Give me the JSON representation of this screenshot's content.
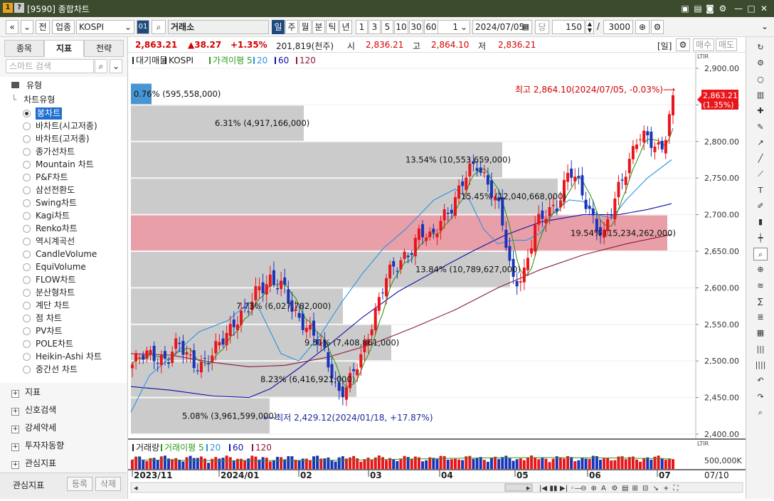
{
  "window": {
    "icon1": "1",
    "icon2": "?",
    "title": "[9590] 종합차트"
  },
  "toolbar": {
    "nav_prev": "«",
    "nav_more": "»",
    "whole": "전",
    "sector": "업종",
    "symbol": "KOSPI",
    "symbol_code": "01",
    "exchange": "거래소",
    "periods": [
      "일",
      "주",
      "월",
      "분",
      "틱",
      "년"
    ],
    "selected_period": "일",
    "intervals": [
      "1",
      "3",
      "5",
      "10",
      "30",
      "60"
    ],
    "spin_value": "1",
    "date": "2024/07/05",
    "dang": "당",
    "count": "150",
    "slash": "/",
    "max_count": "3000"
  },
  "quote": {
    "last": "2,863.21",
    "change": "▲38.27",
    "change_pct": "+1.35%",
    "volume": "201,819(천주)",
    "open_label": "시",
    "open": "2,836.21",
    "high_label": "고",
    "high": "2,864.10",
    "low_label": "저",
    "low": "2,836.21",
    "period_tag": "[일]",
    "buy": "매수",
    "sell": "매도"
  },
  "left_panel": {
    "tabs": [
      "종목",
      "지표",
      "전략"
    ],
    "selected_tab": "지표",
    "search_placeholder": "스마트 검색",
    "section_type": "유형",
    "section_chart_type": "차트유형",
    "chart_types": [
      "봉차트",
      "바차트(시고저종)",
      "바차트(고저종)",
      "종가선차트",
      "Mountain 차트",
      "P&F차트",
      "삼선전환도",
      "Swing차트",
      "Kagi차트",
      "Renko차트",
      "역시계곡선",
      "CandleVolume",
      "EquiVolume",
      "FLOW차트",
      "분산형차트",
      "계단 차트",
      "점 차트",
      "PV차트",
      "POLE차트",
      "Heikin-Ashi 차트",
      "중간선 차트"
    ],
    "selected_chart_type": "봉차트",
    "groups": [
      "지표",
      "신호검색",
      "강세약세",
      "투자자동향",
      "관심지표"
    ],
    "footer_label": "관심지표",
    "register": "등록",
    "delete": "삭제"
  },
  "chart": {
    "legend": [
      "대기매물",
      "KOSPI",
      "가격이평 5",
      "20",
      "60",
      "120"
    ],
    "volume_legend": [
      "거래량",
      "거래이평 5",
      "20",
      "60",
      "120"
    ],
    "high_annotation": "최고 2,864.10(2024/07/05, -0.03%)⟶",
    "low_annotation": "⟵최저 2,429.12(2024/01/18, +17.87%)",
    "last_tag_price": "2,863.21",
    "last_tag_pct": "(1.35%)",
    "ltir": "LTIR",
    "volume_axis_label": "500,000K",
    "last_date": "07/10",
    "colors": {
      "up": "#e8151b",
      "down": "#1a34b8",
      "ma5": "#2c9a1a",
      "ma20": "#2b93e0",
      "ma60": "#1010a8",
      "ma120": "#8b1a3a",
      "profile": "#c8c8c8",
      "profile_max": "#e79aa2",
      "profile_cur": "#3d8fd0"
    }
  },
  "chart_data": {
    "type": "candlestick",
    "symbol": "KOSPI",
    "ylim": [
      2400,
      2900
    ],
    "y_ticks": [
      "2,900.00",
      "2,850.00",
      "2,800.00",
      "2,750.00",
      "2,700.00",
      "2,650.00",
      "2,600.00",
      "2,550.00",
      "2,500.00",
      "2,450.00",
      "2,400.00"
    ],
    "x_ticks": [
      "2023/11",
      "2024/01",
      "02",
      "03",
      "04",
      "05",
      "06",
      "07"
    ],
    "close_path": [
      2495,
      2505,
      2510,
      2502,
      2520,
      2505,
      2495,
      2505,
      2535,
      2560,
      2565,
      2600,
      2615,
      2600,
      2565,
      2555,
      2530,
      2495,
      2460,
      2475,
      2505,
      2565,
      2615,
      2625,
      2650,
      2680,
      2660,
      2700,
      2720,
      2750,
      2770,
      2745,
      2700,
      2610,
      2620,
      2680,
      2700,
      2720,
      2760,
      2730,
      2700,
      2670,
      2720,
      2770,
      2810,
      2795,
      2790,
      2863
    ],
    "volume_profile": [
      {
        "range": [
          2880,
          2850
        ],
        "label": "0.76% (595,558,000)"
      },
      {
        "range": [
          2850,
          2800
        ],
        "label": "6.31% (4,917,166,000)"
      },
      {
        "range": [
          2800,
          2750
        ],
        "label": "13.54% (10,553,659,000)"
      },
      {
        "range": [
          2750,
          2700
        ],
        "label": "15.45% (12,040,668,000)"
      },
      {
        "range": [
          2700,
          2650
        ],
        "label": "19.54% (15,234,262,000)"
      },
      {
        "range": [
          2650,
          2600
        ],
        "label": "13.84% (10,789,627,000)"
      },
      {
        "range": [
          2600,
          2550
        ],
        "label": "7.73% (6,027,782,000)"
      },
      {
        "range": [
          2550,
          2500
        ],
        "label": "9.51% (7,408,861,000)"
      },
      {
        "range": [
          2500,
          2450
        ],
        "label": "8.23% (6,416,921,000)"
      },
      {
        "range": [
          2450,
          2400
        ],
        "label": "5.08% (3,961,599,000)"
      }
    ]
  }
}
